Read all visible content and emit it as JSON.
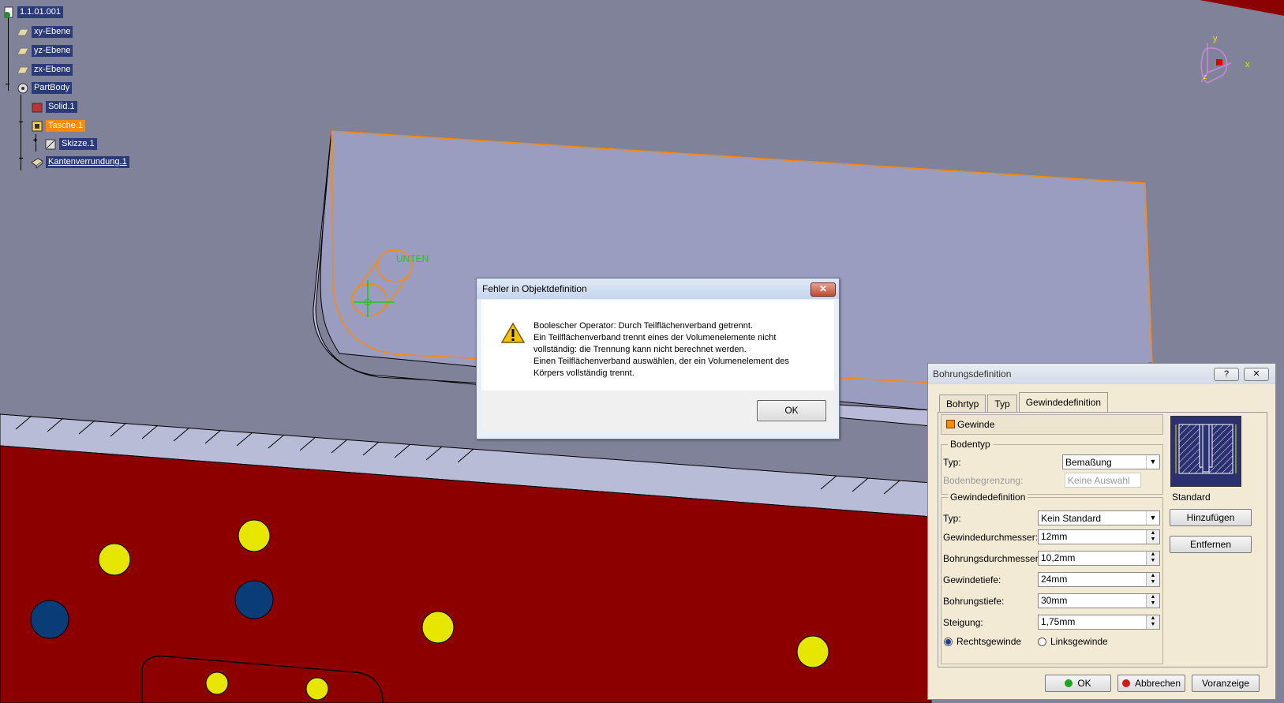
{
  "tree": {
    "root": "1.1.01.001",
    "items": [
      "xy-Ebene",
      "yz-Ebene",
      "zx-Ebene",
      "PartBody",
      "Solid.1",
      "Tasche.1",
      "Skizze.1",
      "Kantenverrundung.1"
    ]
  },
  "viewport": {
    "annotation": "UNTEN",
    "compass_x": "x",
    "compass_y": "y",
    "compass_z": "z"
  },
  "error_dialog": {
    "title": "Fehler in Objektdefinition",
    "close": "✕",
    "lines": [
      "Boolescher Operator: Durch Teilflächenverband getrennt.",
      "Ein Teilflächenverband trennt eines der Volumenelemente nicht",
      "vollständig: die Trennung kann nicht berechnet werden.",
      "Einen Teilflächenverband auswählen, der ein Volumenelement des",
      "Körpers vollständig trennt."
    ],
    "ok": "OK"
  },
  "hole_dialog": {
    "title": "Bohrungsdefinition",
    "help": "?",
    "close": "✕",
    "tabs": [
      "Bohrtyp",
      "Typ",
      "Gewindedefinition"
    ],
    "thread_label": "Gewinde",
    "bottom_group": "Bodentyp",
    "bottom_type_label": "Typ:",
    "bottom_type_value": "Bemaßung",
    "bottom_limit_label": "Bodenbegrenzung:",
    "bottom_limit_value": "Keine Auswahl",
    "thread_group": "Gewindedefinition",
    "type_label": "Typ:",
    "type_value": "Kein Standard",
    "fields": [
      {
        "label": "Gewindedurchmesser:",
        "value": "12mm"
      },
      {
        "label": "Bohrungsdurchmesser:",
        "value": "10,2mm"
      },
      {
        "label": "Gewindetiefe:",
        "value": "24mm"
      },
      {
        "label": "Bohrungstiefe:",
        "value": "30mm"
      },
      {
        "label": "Steigung:",
        "value": "1,75mm"
      }
    ],
    "right_thread": "Rechtsgewinde",
    "left_thread": "Linksgewinde",
    "standard_group": "Standard",
    "add": "Hinzufügen",
    "remove": "Entfernen",
    "ok": "OK",
    "cancel": "Abbrechen",
    "preview": "Voranzeige"
  }
}
